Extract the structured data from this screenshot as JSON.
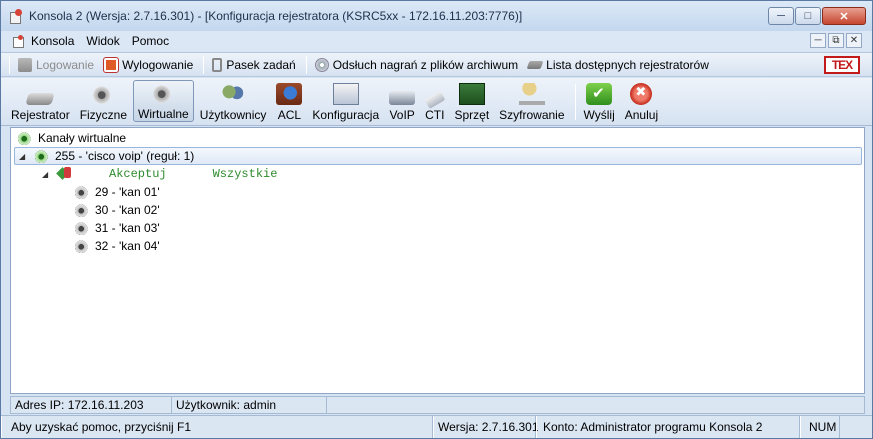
{
  "window": {
    "title": "Konsola 2 (Wersja:  2.7.16.301) - [Konfiguracja rejestratora (KSRC5xx - 172.16.11.203:7776)]",
    "controls": {
      "minimize": "─",
      "maximize": "□",
      "close": "✕"
    }
  },
  "menubar": {
    "items": [
      "Konsola",
      "Widok",
      "Pomoc"
    ],
    "mdi_controls": {
      "minimize": "─",
      "restore": "⧉",
      "close": "✕"
    }
  },
  "toolbar": {
    "logowanie": "Logowanie",
    "wylogowanie": "Wylogowanie",
    "pasek_zadan": "Pasek zadań",
    "odsluch": "Odsłuch nagrań z plików archiwum",
    "lista": "Lista dostępnych rejestratorów",
    "logo": "TEX"
  },
  "ribbon": {
    "rejestrator": "Rejestrator",
    "fizyczne": "Fizyczne",
    "wirtualne": "Wirtualne",
    "uzytkownicy": "Użytkownicy",
    "acl": "ACL",
    "konfiguracja": "Konfiguracja",
    "voip": "VoIP",
    "cti": "CTI",
    "sprzet": "Sprzęt",
    "szyfrowanie": "Szyfrowanie",
    "wyslij": "Wyślij",
    "anuluj": "Anuluj"
  },
  "tree": {
    "root": "Kanały wirtualne",
    "group": "255 - 'cisco voip' (reguł: 1)",
    "rule": {
      "action": "Akceptuj",
      "scope": "Wszystkie"
    },
    "channels": [
      "29 - 'kan 01'",
      "30 - 'kan 02'",
      "31 - 'kan 03'",
      "32 - 'kan 04'"
    ]
  },
  "statusbar1": {
    "ip": "Adres IP: 172.16.11.203",
    "user": "Użytkownik: admin"
  },
  "statusbar2": {
    "help": "Aby uzyskać pomoc, przyciśnij F1",
    "version": "Wersja: 2.7.16.301",
    "account": "Konto: Administrator programu Konsola 2",
    "num": "NUM"
  }
}
